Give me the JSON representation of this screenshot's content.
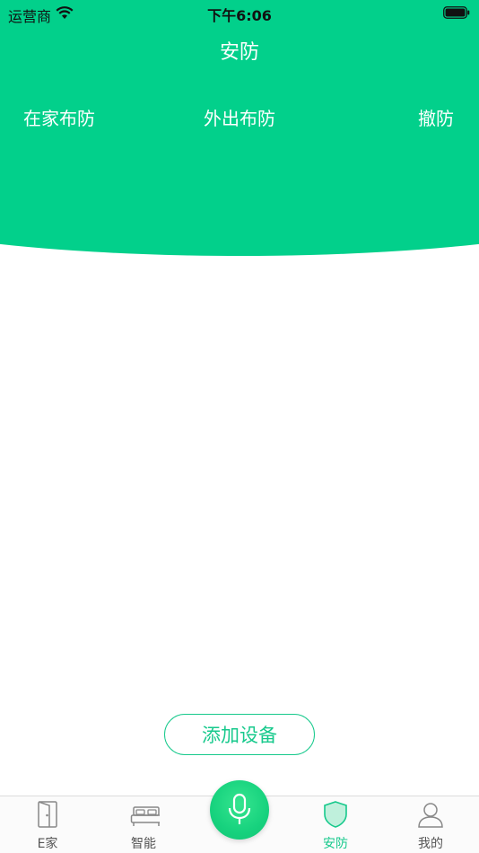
{
  "status_bar": {
    "carrier": "运营商",
    "time": "下午6:06"
  },
  "header": {
    "title": "安防",
    "modes": [
      {
        "label": "在家布防"
      },
      {
        "label": "外出布防"
      },
      {
        "label": "撤防"
      }
    ]
  },
  "main": {
    "add_device_label": "添加设备"
  },
  "tab_bar": {
    "tabs": [
      {
        "label": "E家",
        "icon": "door-icon"
      },
      {
        "label": "智能",
        "icon": "bed-icon"
      },
      {
        "label": "安防",
        "icon": "shield-icon",
        "active": true
      },
      {
        "label": "我的",
        "icon": "user-icon"
      }
    ],
    "center_icon": "microphone-icon"
  },
  "colors": {
    "brand_green": "#02d08b",
    "accent_green": "#17c98c"
  }
}
